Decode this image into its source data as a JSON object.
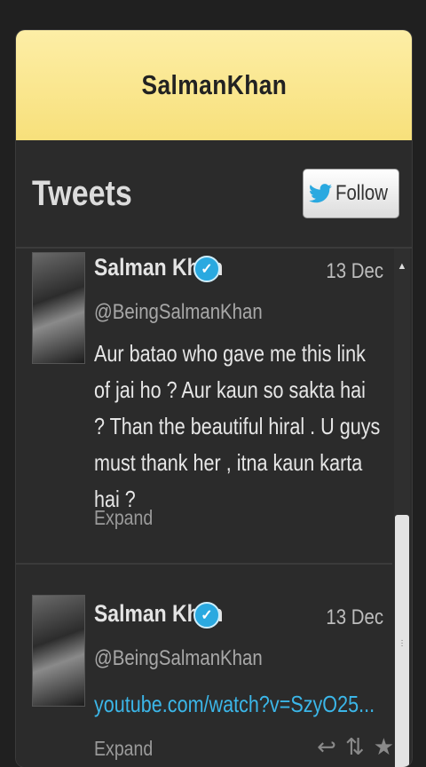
{
  "app": {
    "title": "SalmanKhan"
  },
  "panel": {
    "heading": "Tweets",
    "follow_label": "Follow"
  },
  "tweets": [
    {
      "name": "Salman Khan",
      "handle": "@BeingSalmanKhan",
      "date": "13 Dec",
      "text": "Aur batao who gave me this link of jai ho ? Aur kaun so sakta hai ? Than the beautiful hiral . U guys must thank her , itna kaun karta hai ?",
      "expand_label": "Expand"
    },
    {
      "name": "Salman Khan",
      "handle": "@BeingSalmanKhan",
      "date": "13 Dec",
      "link": "youtube.com/watch?v=SzyO25...",
      "expand_label": "Expand"
    }
  ],
  "colors": {
    "title_bar": "#fbe98f",
    "link": "#3bb6e8",
    "verified": "#2aa9e0",
    "background": "#2b2b2b"
  },
  "icons": [
    "twitter-bird-icon",
    "verified-badge-icon",
    "reply-icon",
    "retweet-icon",
    "favorite-star-icon",
    "scroll-up-arrow-icon"
  ]
}
